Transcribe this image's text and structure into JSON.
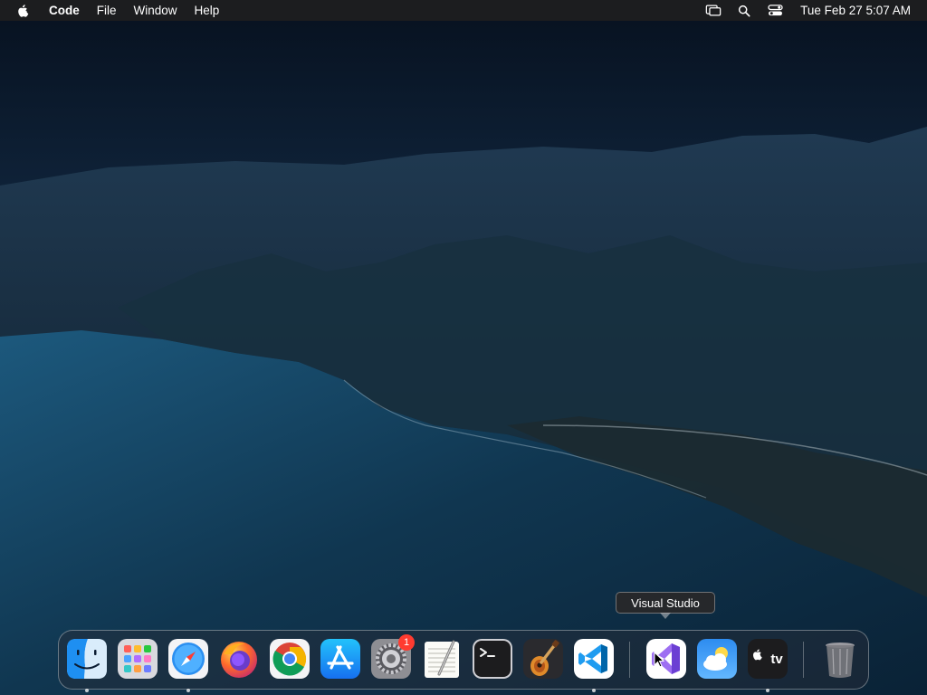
{
  "menubar": {
    "app_name": "Code",
    "menus": [
      "File",
      "Window",
      "Help"
    ],
    "clock": "Tue Feb 27  5:07 AM",
    "status_icons": [
      "screen-mirroring-icon",
      "spotlight-search-icon",
      "control-center-icon"
    ]
  },
  "tooltip": {
    "text": "Visual Studio"
  },
  "dock": {
    "items": [
      {
        "name": "Finder",
        "icon": "finder-icon",
        "running": true
      },
      {
        "name": "Launchpad",
        "icon": "launchpad-icon",
        "running": false
      },
      {
        "name": "Safari",
        "icon": "safari-icon",
        "running": true
      },
      {
        "name": "Firefox",
        "icon": "firefox-icon",
        "running": false
      },
      {
        "name": "Google Chrome",
        "icon": "chrome-icon",
        "running": false
      },
      {
        "name": "App Store",
        "icon": "app-store-icon",
        "running": false
      },
      {
        "name": "System Preferences",
        "icon": "system-preferences-icon",
        "running": false,
        "badge": "1"
      },
      {
        "name": "TextEdit",
        "icon": "textedit-icon",
        "running": false
      },
      {
        "name": "Terminal",
        "icon": "terminal-icon",
        "running": false
      },
      {
        "name": "GarageBand",
        "icon": "garageband-icon",
        "running": false
      },
      {
        "name": "Visual Studio Code",
        "icon": "vscode-icon",
        "running": true
      },
      {
        "name": "Visual Studio",
        "icon": "visual-studio-icon",
        "running": false
      },
      {
        "name": "Weather",
        "icon": "weather-icon",
        "running": false
      },
      {
        "name": "Apple TV",
        "icon": "apple-tv-icon",
        "running": true,
        "label": "tv"
      },
      {
        "name": "Trash",
        "icon": "trash-icon",
        "running": false
      }
    ]
  },
  "colors": {
    "menubar_bg": "#1e1e20",
    "badge_red": "#ff3b30",
    "sky_top": "#0b1c33",
    "ocean": "#123a5a"
  }
}
